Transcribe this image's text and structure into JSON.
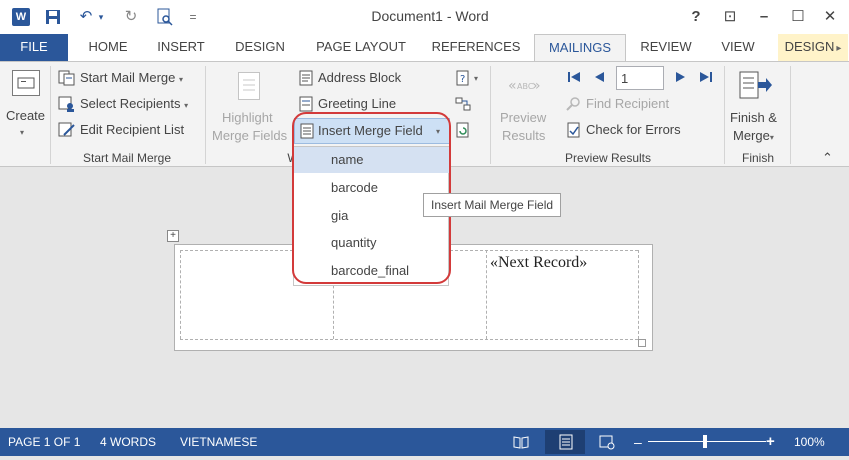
{
  "window": {
    "title": "Document1 - Word",
    "app_icon_letter": "W",
    "help": "?",
    "ribbon_display": "⊡",
    "minimize": "–",
    "maximize": "☐",
    "close": "✕"
  },
  "quick_access": {
    "save": "💾",
    "undo": "↶",
    "undo_caret": "▾",
    "redo": "↻",
    "preview": "🔍",
    "customize": "="
  },
  "tabs": [
    "FILE",
    "HOME",
    "INSERT",
    "DESIGN",
    "PAGE LAYOUT",
    "REFERENCES",
    "MAILINGS",
    "REVIEW",
    "VIEW",
    "DESIGN"
  ],
  "tab_scroll": "▸",
  "ribbon": {
    "create": {
      "line1": "Create",
      "caret": "▾"
    },
    "start_mail_merge": {
      "items": [
        "Start Mail Merge",
        "Select Recipients",
        "Edit Recipient List"
      ],
      "group": "Start Mail Merge"
    },
    "write_insert": {
      "highlight": [
        "Highlight",
        "Merge Fields"
      ],
      "address_block": "Address Block",
      "greeting_line": "Greeting Line",
      "insert_merge_field": "Insert Merge Field",
      "group_partial": "W"
    },
    "preview": {
      "label": [
        "Preview",
        "Results"
      ],
      "record": "1",
      "find_recipient": "Find Recipient",
      "check_errors": "Check for Errors",
      "group": "Preview Results"
    },
    "finish": {
      "label": [
        "Finish &",
        "Merge"
      ],
      "caret": "▾",
      "group": "Finish"
    },
    "collapse": "⌃"
  },
  "dropdown": {
    "items": [
      "name",
      "barcode",
      "gia",
      "quantity",
      "barcode_final"
    ],
    "selected_index": 0
  },
  "tooltip": "Insert Mail Merge Field",
  "document": {
    "next_record": "«Next Record»",
    "move_handle": "+"
  },
  "status": {
    "page": "PAGE 1 OF 1",
    "words": "4 WORDS",
    "language": "VIETNAMESE",
    "zoom_minus": "–",
    "zoom_plus": "+",
    "zoom": "100%"
  },
  "colors": {
    "accent": "#2b579a",
    "ring": "#d33a3a",
    "dropdown_selected": "#d5e1f2"
  }
}
